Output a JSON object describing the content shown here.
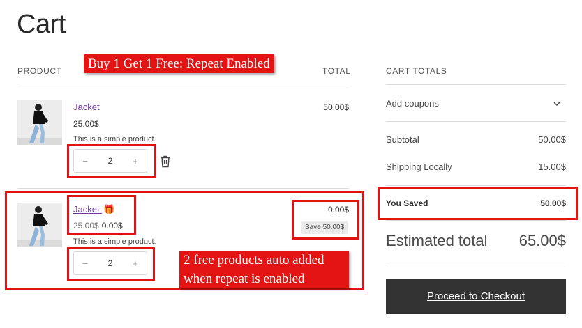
{
  "page": {
    "title": "Cart"
  },
  "table": {
    "product_header": "PRODUCT",
    "total_header": "TOTAL"
  },
  "annotations": {
    "top": "Buy 1 Get 1 Free: Repeat Enabled",
    "bottom_line1": "2 free products auto added",
    "bottom_line2": "when repeat is enabled"
  },
  "items": [
    {
      "name": "Jacket",
      "price": "25.00$",
      "description": "This is a simple product.",
      "quantity": "2",
      "minus": "−",
      "plus": "+",
      "line_total": "50.00$"
    },
    {
      "name": "Jacket",
      "gift_icon": "🎁",
      "original_price": "25.00$",
      "price": "0.00$",
      "description": "This is a simple product.",
      "quantity": "2",
      "minus": "−",
      "plus": "+",
      "line_total": "0.00$",
      "save_badge": "Save 50.00$"
    }
  ],
  "totals": {
    "header": "CART TOTALS",
    "coupons_label": "Add coupons",
    "subtotal_label": "Subtotal",
    "subtotal_value": "50.00$",
    "shipping_label": "Shipping Locally",
    "shipping_value": "15.00$",
    "saved_label": "You Saved",
    "saved_value": "50.00$",
    "estimated_label": "Estimated total",
    "estimated_value": "65.00$",
    "checkout_label": "Proceed to Checkout"
  },
  "colors": {
    "highlight": "#e01212",
    "link": "#6b3fa0",
    "checkout_bg": "#333333"
  }
}
